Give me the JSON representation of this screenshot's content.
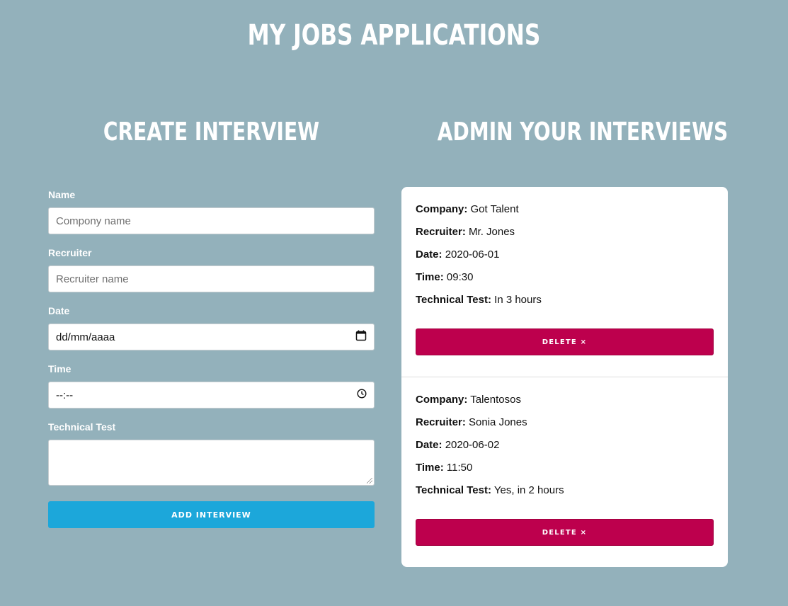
{
  "page": {
    "title": "MY JOBS APPLICATIONS"
  },
  "create": {
    "title": "CREATE INTERVIEW",
    "fields": {
      "name": {
        "label": "Name",
        "placeholder": "Compony name"
      },
      "recruiter": {
        "label": "Recruiter",
        "placeholder": "Recruiter name"
      },
      "date": {
        "label": "Date",
        "value": "dd/mm/aaaa",
        "icon": "calendar-icon"
      },
      "time": {
        "label": "Time",
        "value": "--:--",
        "icon": "clock-icon"
      },
      "technical_test": {
        "label": "Technical Test",
        "value": ""
      }
    },
    "submit_label": "ADD INTERVIEW"
  },
  "admin": {
    "title": "ADMIN YOUR INTERVIEWS",
    "labels": {
      "company": "Company:",
      "recruiter": "Recruiter:",
      "date": "Date:",
      "time": "Time:",
      "technical_test": "Technical Test:"
    },
    "interviews": [
      {
        "company": "Got Talent",
        "recruiter": "Mr. Jones",
        "date": "2020-06-01",
        "time": "09:30",
        "technical_test": "In 3 hours",
        "delete_label": "DELETE ×"
      },
      {
        "company": "Talentosos",
        "recruiter": "Sonia Jones",
        "date": "2020-06-02",
        "time": "11:50",
        "technical_test": "Yes, in 2 hours",
        "delete_label": "DELETE ×"
      }
    ]
  },
  "colors": {
    "background": "#93b1bb",
    "add_button": "#1ca7da",
    "delete_button": "#bd004d"
  }
}
